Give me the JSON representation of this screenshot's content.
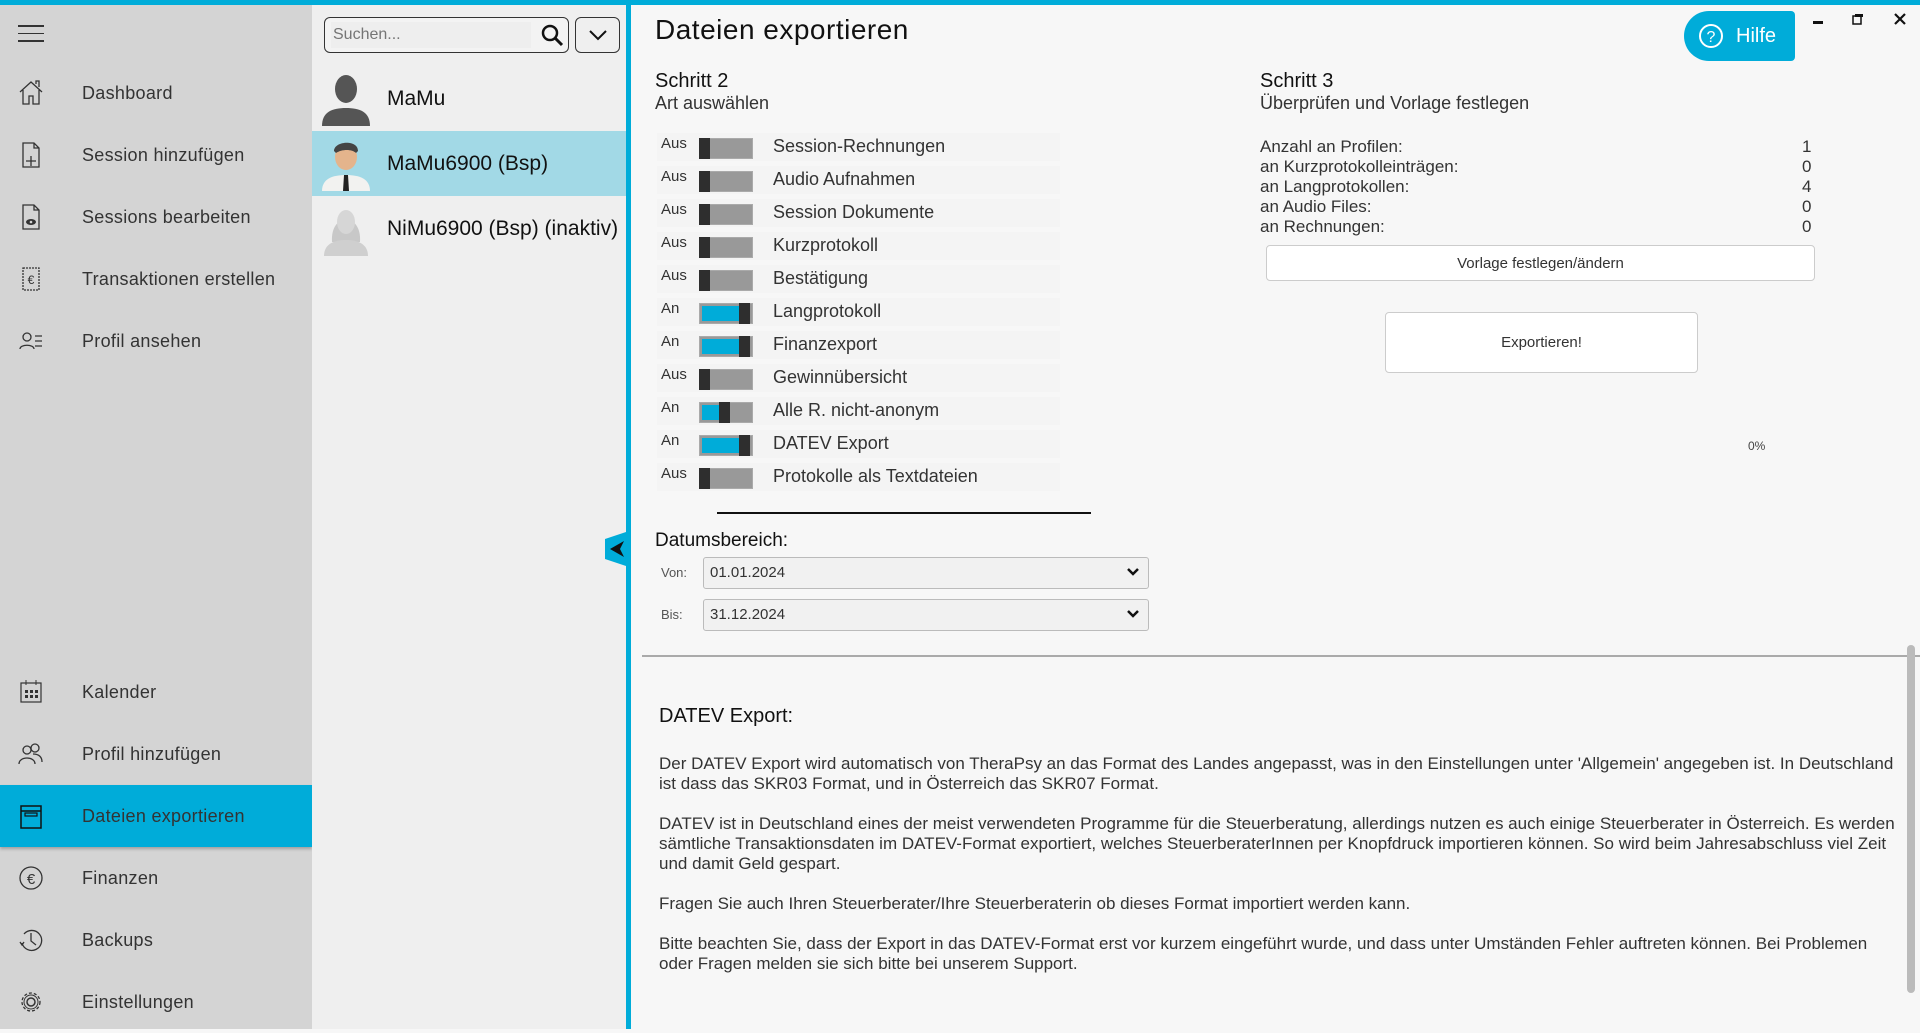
{
  "sidebar": {
    "items": [
      {
        "label": "Dashboard",
        "icon": "home-icon"
      },
      {
        "label": "Session hinzufügen",
        "icon": "file-plus-icon"
      },
      {
        "label": "Sessions bearbeiten",
        "icon": "file-eye-icon"
      },
      {
        "label": "Transaktionen erstellen",
        "icon": "receipt-euro-icon"
      },
      {
        "label": "Profil ansehen",
        "icon": "profile-list-icon"
      },
      {
        "label": "Kalender",
        "icon": "calendar-icon"
      },
      {
        "label": "Profil hinzufügen",
        "icon": "users-icon"
      },
      {
        "label": "Dateien exportieren",
        "icon": "archive-icon",
        "active": true
      },
      {
        "label": "Finanzen",
        "icon": "euro-circle-icon"
      },
      {
        "label": "Backups",
        "icon": "history-icon"
      },
      {
        "label": "Einstellungen",
        "icon": "gear-icon"
      }
    ]
  },
  "profiles": {
    "search_placeholder": "Suchen...",
    "items": [
      {
        "name": "MaMu"
      },
      {
        "name": "MaMu6900 (Bsp)",
        "selected": true
      },
      {
        "name": "NiMu6900 (Bsp) (inaktiv)"
      }
    ]
  },
  "header": {
    "title": "Dateien exportieren",
    "help_label": "Hilfe"
  },
  "accent": "#00acd9",
  "step2": {
    "title": "Schritt 2",
    "subtitle": "Art auswählen",
    "toggles": [
      {
        "state": "Aus",
        "label": "Session-Rechnungen",
        "on": false
      },
      {
        "state": "Aus",
        "label": "Audio Aufnahmen",
        "on": false
      },
      {
        "state": "Aus",
        "label": "Session Dokumente",
        "on": false
      },
      {
        "state": "Aus",
        "label": "Kurzprotokoll",
        "on": false
      },
      {
        "state": "Aus",
        "label": "Bestätigung",
        "on": false
      },
      {
        "state": "An",
        "label": "Langprotokoll",
        "on": true
      },
      {
        "state": "An",
        "label": "Finanzexport",
        "on": true
      },
      {
        "state": "Aus",
        "label": "Gewinnübersicht",
        "on": false
      },
      {
        "state": "An",
        "label": "Alle R. nicht-anonym",
        "on": true,
        "position": 0.5
      },
      {
        "state": "An",
        "label": "DATEV Export",
        "on": true
      },
      {
        "state": "Aus",
        "label": "Protokolle als Textdateien",
        "on": false
      }
    ]
  },
  "date_range": {
    "label": "Datumsbereich:",
    "from_label": "Von:",
    "from": "01.01.2024",
    "to_label": "Bis:",
    "to": "31.12.2024"
  },
  "step3": {
    "title": "Schritt 3",
    "subtitle": "Überprüfen und Vorlage festlegen",
    "stats": [
      {
        "label": "Anzahl an Profilen:",
        "value": "1"
      },
      {
        "label": "an Kurzprotokolleinträgen:",
        "value": "0"
      },
      {
        "label": "an Langprotokollen:",
        "value": "4"
      },
      {
        "label": "an Audio Files:",
        "value": "0"
      },
      {
        "label": "an Rechnungen:",
        "value": "0"
      }
    ],
    "template_button": "Vorlage festlegen/ändern",
    "export_button": "Exportieren!",
    "progress": "0%"
  },
  "info": {
    "title": "DATEV Export:",
    "paragraphs": [
      "Der DATEV Export wird automatisch von TheraPsy an das Format des Landes angepasst, was in den Einstellungen unter 'Allgemein' angegeben ist. In Deutschland ist dass das SKR03 Format, und in Österreich das SKR07 Format.",
      "DATEV ist in Deutschland eines der meist verwendeten Programme für die Steuerberatung, allerdings nutzen es auch einige Steuerberater in Österreich. Es werden sämtliche Transaktionsdaten im DATEV-Format exportiert, welches SteuerberaterInnen per Knopfdruck importieren können. So wird beim Jahresabschluss viel Zeit und damit Geld gespart.",
      "Fragen Sie auch Ihren Steuerberater/Ihre Steuerberaterin ob dieses Format importiert werden kann.",
      "Bitte beachten Sie, dass der Export in das DATEV-Format erst vor kurzem eingeführt wurde, und dass unter Umständen Fehler auftreten können. Bei Problemen oder Fragen melden sie sich bitte bei unserem Support."
    ]
  }
}
